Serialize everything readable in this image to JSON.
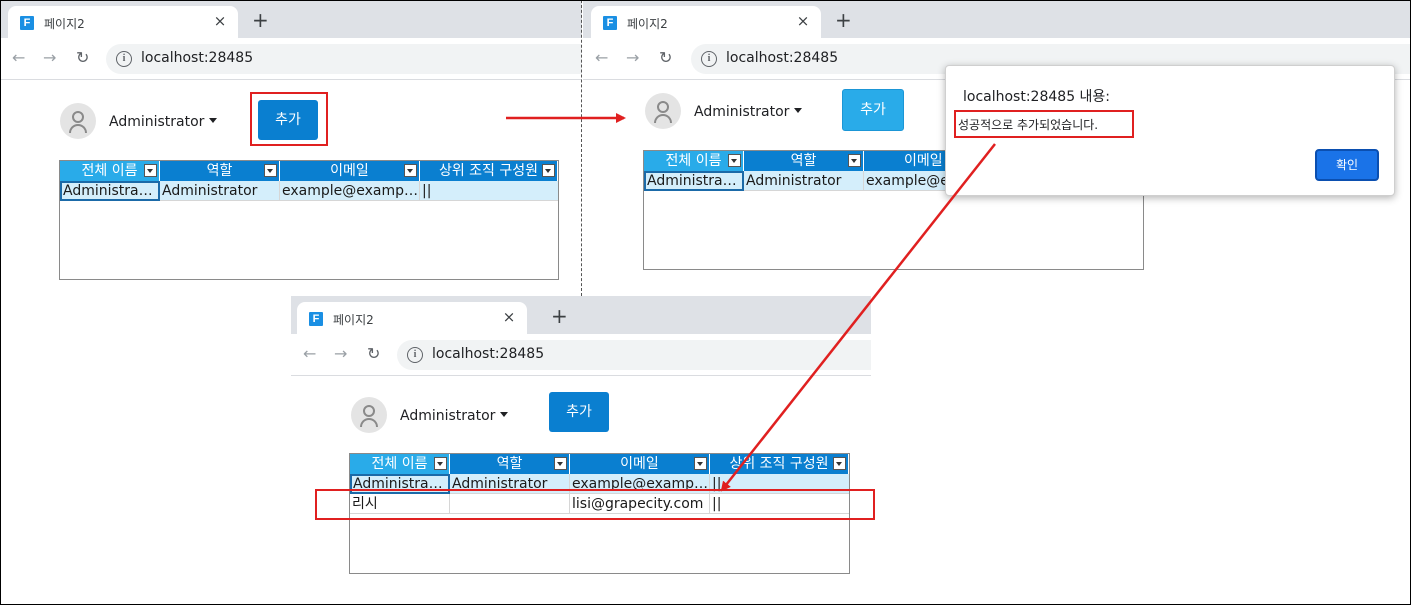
{
  "browser": {
    "tab_title": "페이지2",
    "tab_close": "×",
    "new_tab": "+",
    "url": "localhost:28485",
    "back": "←",
    "forward": "→",
    "reload": "↻"
  },
  "app": {
    "favicon_letter": "F",
    "user_name": "Administrator",
    "add_button": "추가"
  },
  "grid": {
    "columns": [
      "전체 이름",
      "역할",
      "이메일",
      "상위 조직 구성원"
    ],
    "rows_before": [
      [
        "Administrator",
        "Administrator",
        "example@example…",
        "||"
      ]
    ],
    "rows_after": [
      [
        "Administrator",
        "Administrator",
        "example@example…",
        "||"
      ],
      [
        "리시",
        "",
        "lisi@grapecity.com",
        "||"
      ]
    ],
    "middle_visible_columns": [
      "전체 이름",
      "역할",
      "이메일"
    ],
    "middle_visible_row": [
      "Administrator",
      "Administrator",
      "example@ex"
    ]
  },
  "dialog": {
    "title": "localhost:28485 내용:",
    "message": "성공적으로 추가되었습니다.",
    "ok_button": "확인"
  },
  "colors": {
    "header_blue": "#0a7fd0",
    "header_active": "#29abe9",
    "highlight_red": "#e02020",
    "dialog_button": "#1a73e8"
  }
}
